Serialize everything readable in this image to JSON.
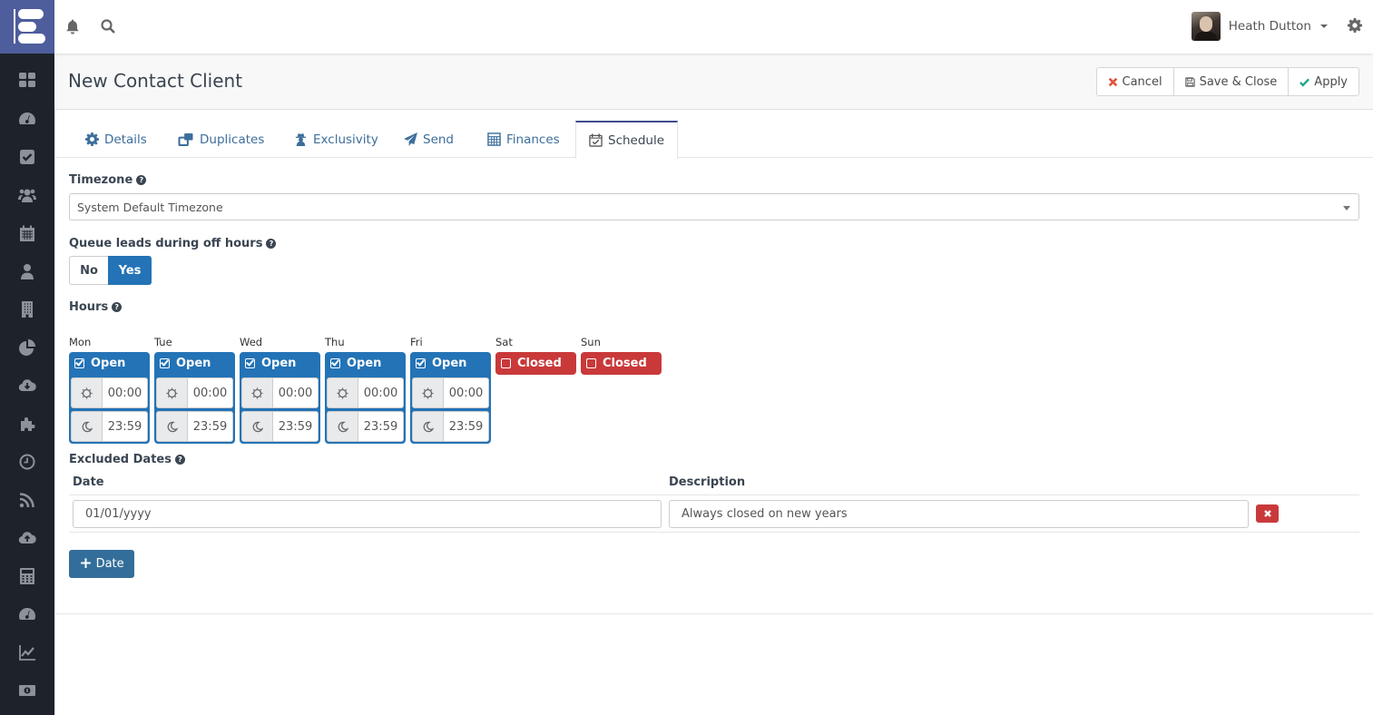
{
  "topbar": {
    "user_name": "Heath Dutton",
    "icons": [
      "bell-icon",
      "search-icon",
      "gear-icon"
    ]
  },
  "sidebar": {
    "items": [
      "dashboard-icon",
      "speedometer-icon",
      "checkbox-icon",
      "users-icon",
      "calendar-icon",
      "user-icon",
      "building-icon",
      "pie-chart-icon",
      "cloud-download-icon",
      "puzzle-icon",
      "clock-icon",
      "rss-icon",
      "cloud-upload-icon",
      "calculator-icon",
      "speedometer-icon",
      "line-chart-icon",
      "money-icon"
    ]
  },
  "header": {
    "title": "New Contact Client",
    "buttons": {
      "cancel": "Cancel",
      "save_close": "Save & Close",
      "apply": "Apply"
    }
  },
  "tabs": [
    {
      "label": "Details",
      "icon": "gear-icon"
    },
    {
      "label": "Duplicates",
      "icon": "clone-icon"
    },
    {
      "label": "Exclusivity",
      "icon": "user-secret-icon"
    },
    {
      "label": "Send",
      "icon": "paper-plane-icon"
    },
    {
      "label": "Finances",
      "icon": "calculator-icon"
    },
    {
      "label": "Schedule",
      "icon": "calendar-check-icon",
      "active": true
    }
  ],
  "form": {
    "timezone_label": "Timezone",
    "timezone_value": "System Default Timezone",
    "queue_label": "Queue leads during off hours",
    "queue_options": {
      "no": "No",
      "yes": "Yes"
    },
    "queue_selected": "Yes",
    "hours_label": "Hours",
    "days": [
      {
        "name": "Mon",
        "status": "Open",
        "open": true,
        "start": "00:00",
        "end": "23:59"
      },
      {
        "name": "Tue",
        "status": "Open",
        "open": true,
        "start": "00:00",
        "end": "23:59"
      },
      {
        "name": "Wed",
        "status": "Open",
        "open": true,
        "start": "00:00",
        "end": "23:59"
      },
      {
        "name": "Thu",
        "status": "Open",
        "open": true,
        "start": "00:00",
        "end": "23:59"
      },
      {
        "name": "Fri",
        "status": "Open",
        "open": true,
        "start": "00:00",
        "end": "23:59"
      },
      {
        "name": "Sat",
        "status": "Closed",
        "open": false
      },
      {
        "name": "Sun",
        "status": "Closed",
        "open": false
      }
    ],
    "excluded_label": "Excluded Dates",
    "excluded_columns": {
      "date": "Date",
      "description": "Description"
    },
    "excluded_rows": [
      {
        "date": "01/01/yyyy",
        "description": "Always closed on new years"
      }
    ],
    "add_date_label": "Date"
  },
  "colors": {
    "primary": "#2373b6",
    "danger": "#c9393a",
    "sidebar": "#1e232b",
    "logo": "#4e5d9c"
  }
}
